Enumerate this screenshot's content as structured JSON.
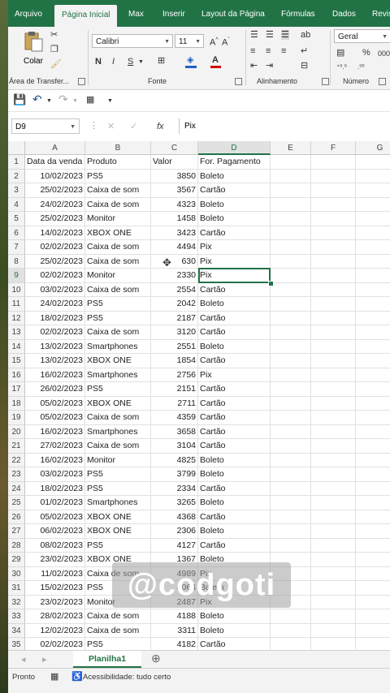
{
  "ribbon_tabs": [
    "Arquivo",
    "Página Inicial",
    "Max",
    "Inserir",
    "Layout da Página",
    "Fórmulas",
    "Dados",
    "Revis"
  ],
  "ribbon": {
    "paste_label": "Colar",
    "clipboard_group": "Área de Transfer...",
    "font_group": "Fonte",
    "alignment_group": "Alinhamento",
    "number_group": "Número",
    "font_name": "Calibri",
    "font_size": "11",
    "number_format": "Geral",
    "bold": "N",
    "italic": "I",
    "underline": "S",
    "percent": "%",
    "thousands": "000"
  },
  "formula_bar": {
    "name_box": "D9",
    "fx": "fx",
    "content": "Pix"
  },
  "columns": [
    "A",
    "B",
    "C",
    "D",
    "E",
    "F",
    "G"
  ],
  "row_numbers": [
    "1",
    "2",
    "3",
    "4",
    "5",
    "6",
    "7",
    "8",
    "9",
    "10",
    "11",
    "12",
    "13",
    "14",
    "15",
    "16",
    "17",
    "18",
    "19",
    "20",
    "21",
    "22",
    "23",
    "24",
    "25",
    "26",
    "27",
    "28",
    "29",
    "30",
    "31",
    "32",
    "33",
    "34",
    "35"
  ],
  "rows": [
    [
      "Data da venda",
      "Produto",
      "Valor",
      "For. Pagamento"
    ],
    [
      "10/02/2023",
      "PS5",
      "3850",
      "Boleto"
    ],
    [
      "25/02/2023",
      "Caixa de som",
      "3567",
      "Cartão"
    ],
    [
      "24/02/2023",
      "Caixa de som",
      "4323",
      "Boleto"
    ],
    [
      "25/02/2023",
      "Monitor",
      "1458",
      "Boleto"
    ],
    [
      "14/02/2023",
      "XBOX ONE",
      "3423",
      "Cartão"
    ],
    [
      "02/02/2023",
      "Caixa de som",
      "4494",
      "Pix"
    ],
    [
      "25/02/2023",
      "Caixa de som",
      "630",
      "Pix"
    ],
    [
      "02/02/2023",
      "Monitor",
      "2330",
      "Pix"
    ],
    [
      "03/02/2023",
      "Caixa de som",
      "2554",
      "Cartão"
    ],
    [
      "24/02/2023",
      "PS5",
      "2042",
      "Boleto"
    ],
    [
      "18/02/2023",
      "PS5",
      "2187",
      "Cartão"
    ],
    [
      "02/02/2023",
      "Caixa de som",
      "3120",
      "Cartão"
    ],
    [
      "13/02/2023",
      "Smartphones",
      "2551",
      "Boleto"
    ],
    [
      "13/02/2023",
      "XBOX ONE",
      "1854",
      "Cartão"
    ],
    [
      "16/02/2023",
      "Smartphones",
      "2756",
      "Pix"
    ],
    [
      "26/02/2023",
      "PS5",
      "2151",
      "Cartão"
    ],
    [
      "05/02/2023",
      "XBOX ONE",
      "2711",
      "Cartão"
    ],
    [
      "05/02/2023",
      "Caixa de som",
      "4359",
      "Cartão"
    ],
    [
      "16/02/2023",
      "Smartphones",
      "3658",
      "Cartão"
    ],
    [
      "27/02/2023",
      "Caixa de som",
      "3104",
      "Cartão"
    ],
    [
      "16/02/2023",
      "Monitor",
      "4825",
      "Boleto"
    ],
    [
      "03/02/2023",
      "PS5",
      "3799",
      "Boleto"
    ],
    [
      "18/02/2023",
      "PS5",
      "2334",
      "Cartão"
    ],
    [
      "01/02/2023",
      "Smartphones",
      "3265",
      "Boleto"
    ],
    [
      "05/02/2023",
      "XBOX ONE",
      "4368",
      "Cartão"
    ],
    [
      "06/02/2023",
      "XBOX ONE",
      "2306",
      "Boleto"
    ],
    [
      "08/02/2023",
      "PS5",
      "4127",
      "Cartão"
    ],
    [
      "23/02/2023",
      "XBOX ONE",
      "1367",
      "Boleto"
    ],
    [
      "11/02/2023",
      "Caixa de som",
      "4989",
      "Pix"
    ],
    [
      "15/02/2023",
      "PS5",
      "4064",
      "Boleto"
    ],
    [
      "23/02/2023",
      "Monitor",
      "2487",
      "Pix"
    ],
    [
      "28/02/2023",
      "Caixa de som",
      "4188",
      "Boleto"
    ],
    [
      "12/02/2023",
      "Caixa de som",
      "3311",
      "Boleto"
    ],
    [
      "02/02/2023",
      "PS5",
      "4182",
      "Cartão"
    ]
  ],
  "watermark": "@codgoti",
  "sheet_tab": "Planilha1",
  "status": {
    "ready": "Pronto",
    "accessibility": "Acessibilidade: tudo certo"
  },
  "colors": {
    "excel_green": "#217346",
    "ribbon_bg": "#f3f3f3"
  }
}
